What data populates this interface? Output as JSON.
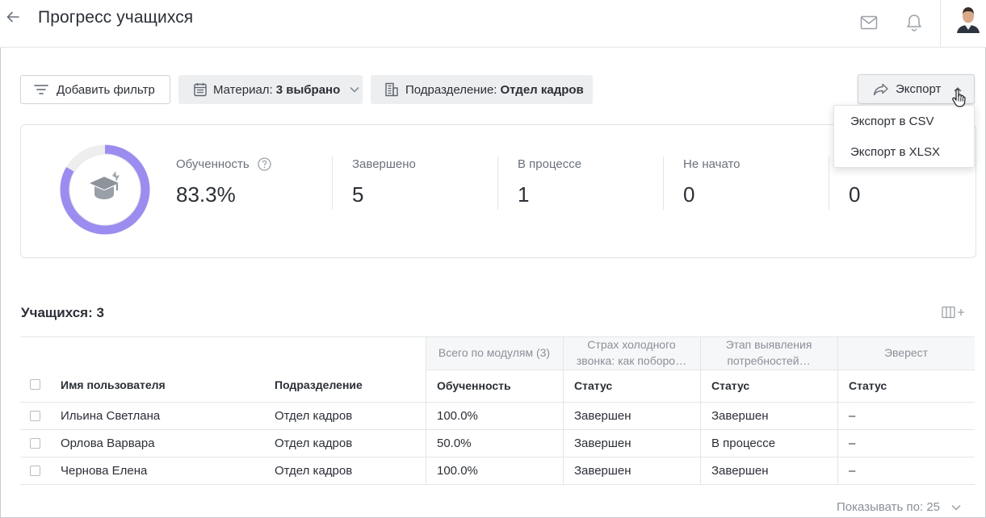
{
  "header": {
    "title": "Прогресс учащихся",
    "icons": [
      "arrow-left-icon",
      "mail-icon",
      "bell-icon",
      "avatar"
    ]
  },
  "toolbar": {
    "add_filter_label": "Добавить фильтр",
    "material_label": "Материал:",
    "material_value": "3 выбрано",
    "department_label": "Подразделение:",
    "department_value": "Отдел кадров",
    "export_label": "Экспорт"
  },
  "export_menu": {
    "items": [
      "Экспорт в CSV",
      "Экспорт в XLSX"
    ]
  },
  "stats": {
    "progress_fraction": 0.833,
    "items": [
      {
        "label": "Обученность",
        "value": "83.3%"
      },
      {
        "label": "Завершено",
        "value": "5"
      },
      {
        "label": "В процессе",
        "value": "1"
      },
      {
        "label": "Не начато",
        "value": "0"
      },
      {
        "label": "",
        "value": "0"
      }
    ]
  },
  "colors": {
    "accent": "#9b8cf0",
    "ring_track": "#eeeeee",
    "muted": "#8a9099"
  },
  "table": {
    "count_label": "Учащихся: 3",
    "group_headers": [
      "Всего по модулям (3)",
      "Страх холодного звонка: как поборо…",
      "Этап выявления потребностей…",
      "Эверест"
    ],
    "columns": [
      "Имя пользователя",
      "Подразделение",
      "Обученность",
      "Статус",
      "Статус",
      "Статус"
    ],
    "rows": [
      [
        "Ильина Светлана",
        "Отдел кадров",
        "100.0%",
        "Завершен",
        "Завершен",
        "–"
      ],
      [
        "Орлова Варвара",
        "Отдел кадров",
        "50.0%",
        "Завершен",
        "В процессе",
        "–"
      ],
      [
        "Чернова Елена",
        "Отдел кадров",
        "100.0%",
        "Завершен",
        "Завершен",
        "–"
      ]
    ]
  },
  "pagination": {
    "label": "Показывать по: 25"
  }
}
